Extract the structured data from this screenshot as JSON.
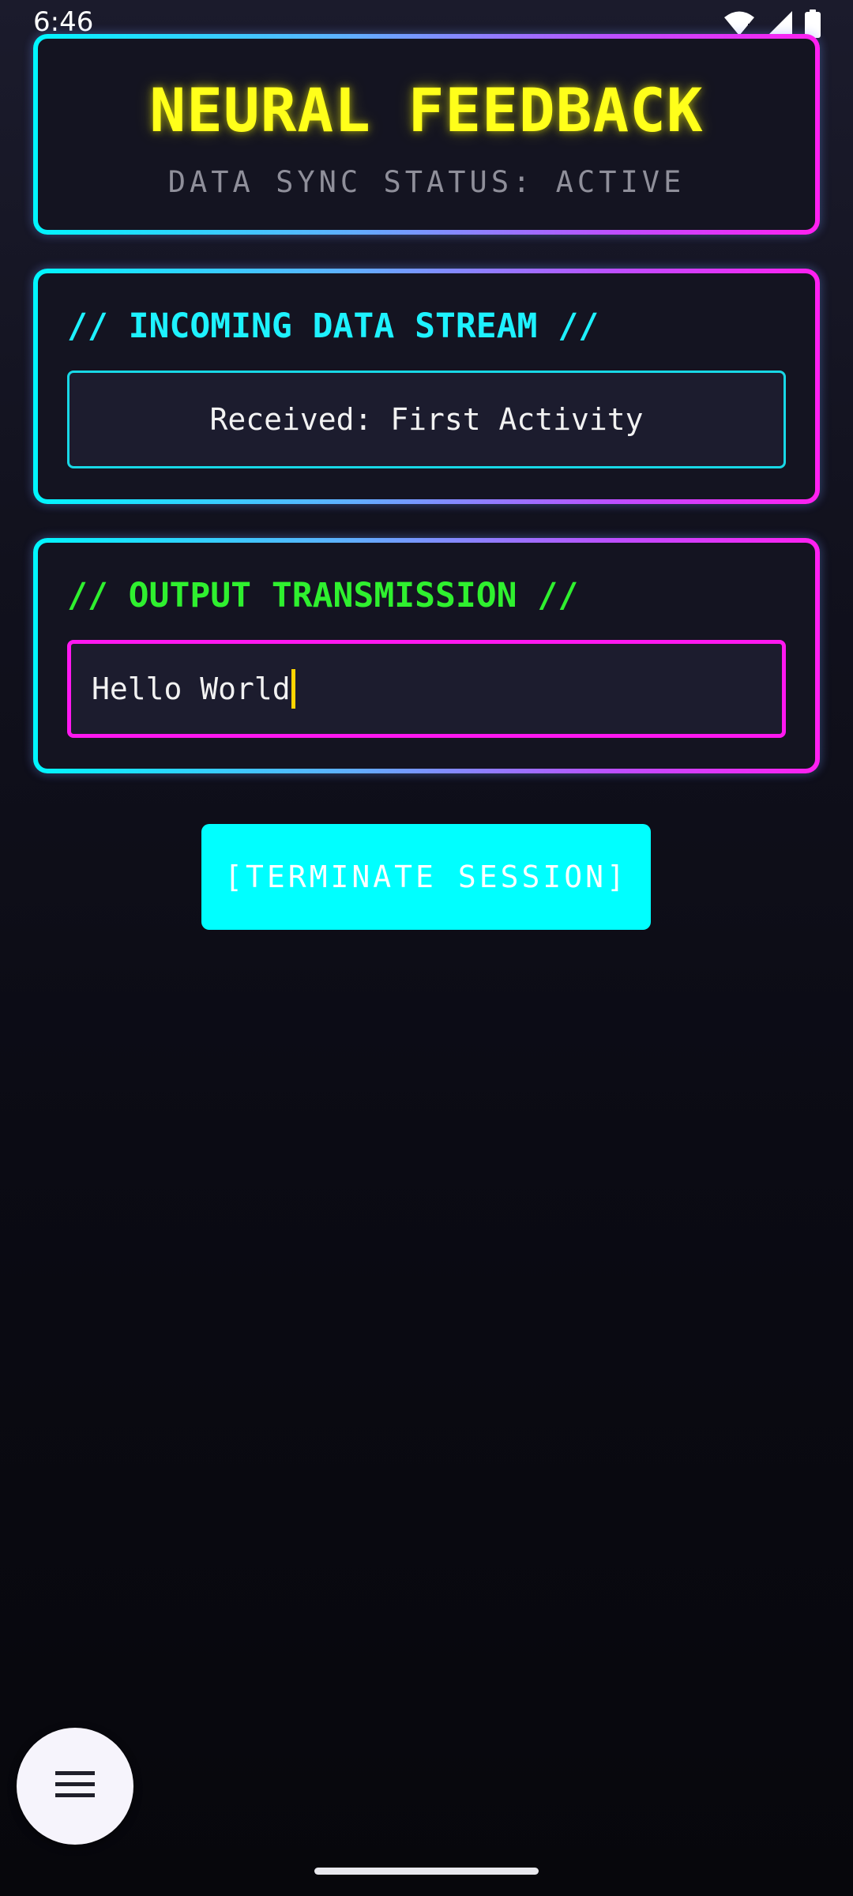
{
  "status_bar": {
    "time": "6:46",
    "icons": [
      "wifi-icon",
      "signal-icon",
      "battery-icon"
    ]
  },
  "header": {
    "title": "NEURAL FEEDBACK",
    "subtitle": "DATA SYNC STATUS: ACTIVE"
  },
  "incoming": {
    "heading": "// INCOMING DATA STREAM //",
    "value": "Received: First Activity"
  },
  "output": {
    "heading": "// OUTPUT TRANSMISSION //",
    "value": "Hello World"
  },
  "actions": {
    "terminate_label": "[TERMINATE SESSION]"
  },
  "fab": {
    "icon": "menu-icon"
  },
  "colors": {
    "title": "#ffff1a",
    "incoming_heading": "#1ef2ff",
    "output_heading": "#2ff02f",
    "button_bg": "#00ffff",
    "input_border": "#ff18f0",
    "caret": "#ffd400"
  }
}
